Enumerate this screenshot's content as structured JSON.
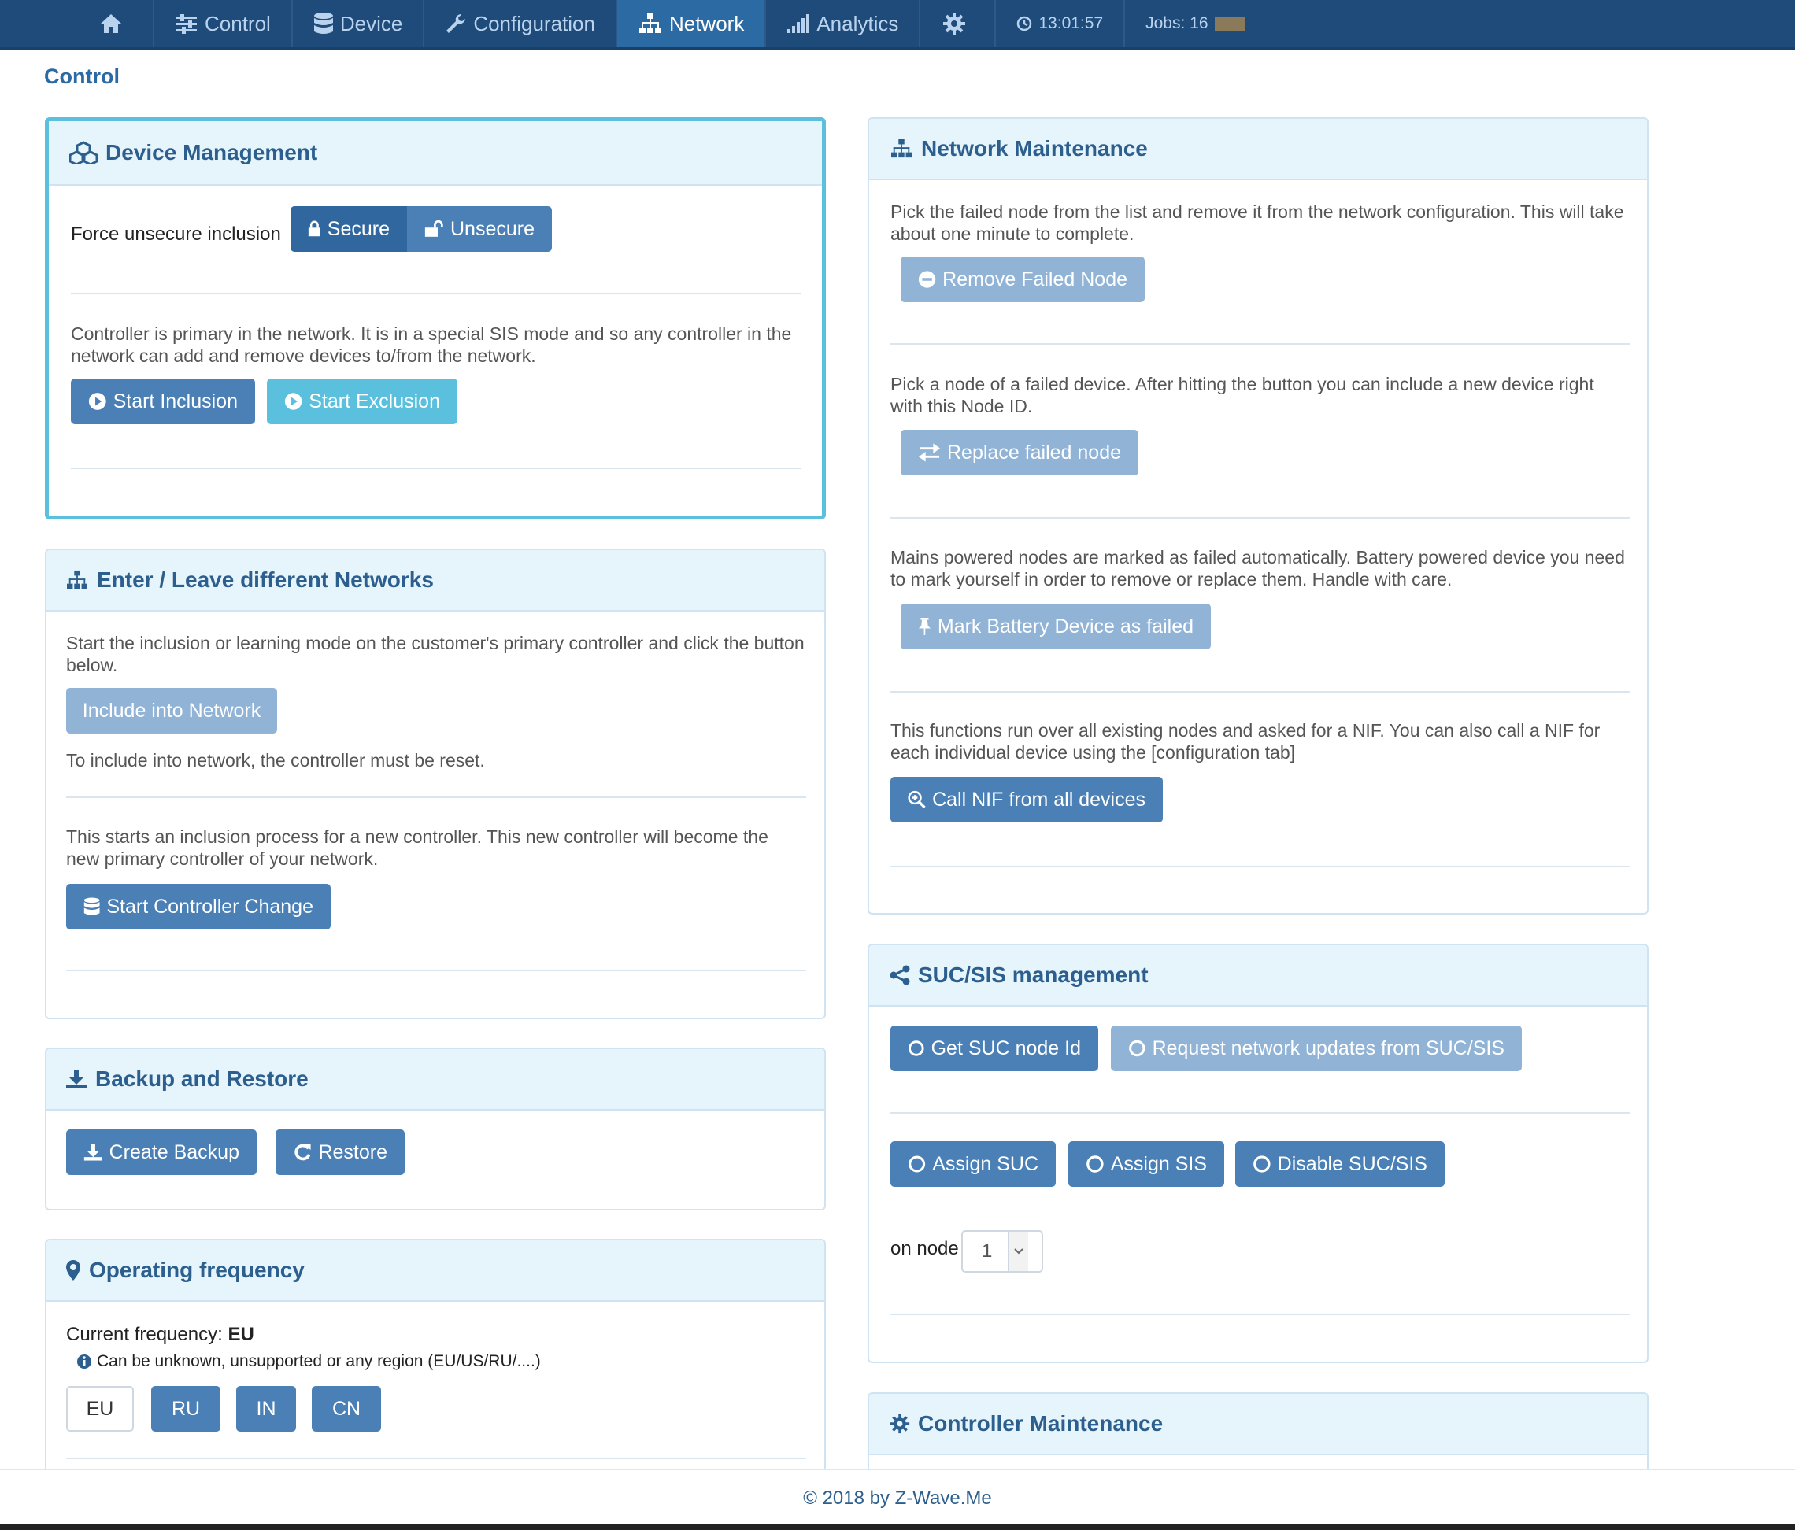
{
  "nav": {
    "items": [
      {
        "label": ""
      },
      {
        "label": "Control"
      },
      {
        "label": "Device"
      },
      {
        "label": "Configuration"
      },
      {
        "label": "Network"
      },
      {
        "label": "Analytics"
      },
      {
        "label": ""
      }
    ],
    "clock": "13:01:57",
    "jobs": "Jobs: 16"
  },
  "page_title": "Control",
  "device_management": {
    "title": "Device Management",
    "force_label": "Force unsecure inclusion",
    "secure_label": "Secure",
    "unsecure_label": "Unsecure",
    "info": "Controller is primary in the network. It is in a special SIS mode and so any controller in the network can add and remove devices to/from the network.",
    "start_inclusion": "Start Inclusion",
    "start_exclusion": "Start Exclusion"
  },
  "enter_leave": {
    "title": "Enter / Leave different Networks",
    "info1": "Start the inclusion or learning mode on the customer's primary controller and click the button below.",
    "include_btn": "Include into Network",
    "note": "To include into network, the controller must be reset.",
    "info2": "This starts an inclusion process for a new controller. This new controller will become the new primary controller of your network.",
    "change_btn": "Start Controller Change"
  },
  "backup": {
    "title": "Backup and Restore",
    "create_btn": "Create Backup",
    "restore_btn": "Restore"
  },
  "frequency": {
    "title": "Operating frequency",
    "current_label": "Current frequency:",
    "current_value": "EU",
    "hint": "Can be unknown, unsupported or any region (EU/US/RU/....)",
    "options": [
      "EU",
      "RU",
      "IN",
      "CN"
    ]
  },
  "network_maintenance": {
    "title": "Network Maintenance",
    "info1": "Pick the failed node from the list and remove it from the network configuration. This will take about one minute to complete.",
    "remove_btn": "Remove Failed Node",
    "info2": "Pick a node of a failed device. After hitting the button you can include a new device right with this Node ID.",
    "replace_btn": "Replace failed node",
    "info3": "Mains powered nodes are marked as failed automatically. Battery powered device you need to mark yourself in order to remove or replace them. Handle with care.",
    "mark_btn": "Mark Battery Device as failed",
    "info4": "This functions run over all existing nodes and asked for a NIF. You can also call a NIF for each individual device using the [configuration tab]",
    "nif_btn": "Call NIF from all devices"
  },
  "suc_sis": {
    "title": "SUC/SIS management",
    "get_btn": "Get SUC node Id",
    "request_btn": "Request network updates from SUC/SIS",
    "assign_suc": "Assign SUC",
    "assign_sis": "Assign SIS",
    "disable_btn": "Disable SUC/SIS",
    "on_node_label": "on node",
    "node_value": "1"
  },
  "controller_maintenance": {
    "title": "Controller Maintenance"
  },
  "footer": "© 2018 by Z-Wave.Me",
  "colors": {
    "nav_bg": "#1f4b7a",
    "nav_active": "#2c6aa3",
    "primary_btn": "#4a80b6",
    "muted_btn": "#90b3d6",
    "info_btn": "#5bc0de",
    "panel_head_bg": "#e6f4fc"
  }
}
